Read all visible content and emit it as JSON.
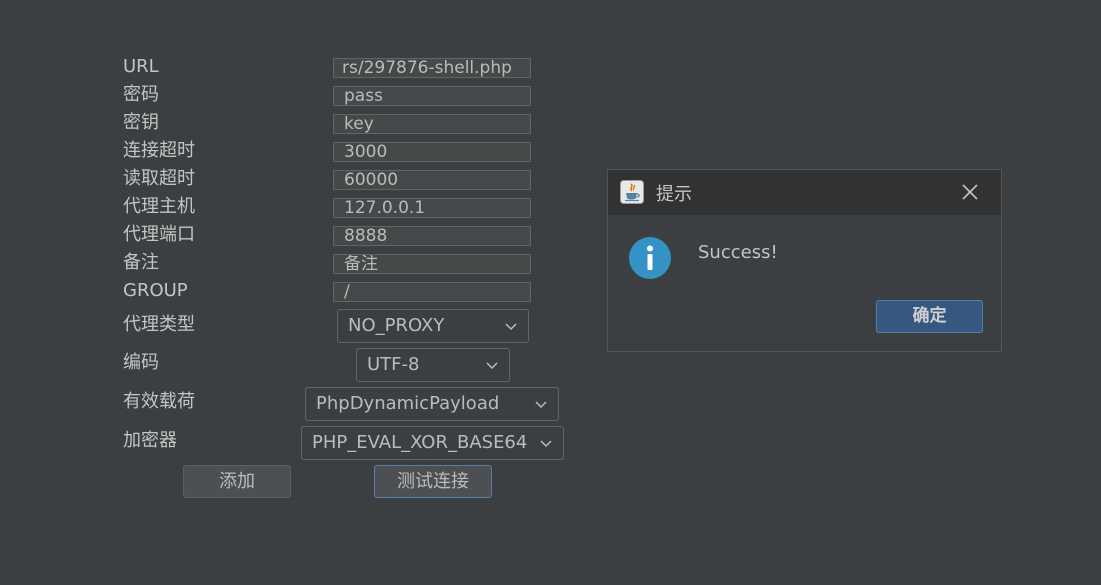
{
  "form": {
    "labels": {
      "url": "URL",
      "password": "密码",
      "key": "密钥",
      "connect_timeout": "连接超时",
      "read_timeout": "读取超时",
      "proxy_host": "代理主机",
      "proxy_port": "代理端口",
      "remark": "备注",
      "group": "GROUP",
      "proxy_type": "代理类型",
      "encoding": "编码",
      "payload": "有效载荷",
      "cryption": "加密器"
    },
    "values": {
      "url": "rs/297876-shell.php",
      "password": "pass",
      "key": "key",
      "connect_timeout": "3000",
      "read_timeout": "60000",
      "proxy_host": "127.0.0.1",
      "proxy_port": "8888",
      "remark": "备注",
      "group": "/"
    },
    "selects": {
      "proxy_type": "NO_PROXY",
      "encoding": "UTF-8",
      "payload": "PhpDynamicPayload",
      "cryption": "PHP_EVAL_XOR_BASE64"
    },
    "buttons": {
      "add": "添加",
      "test": "测试连接"
    }
  },
  "dialog": {
    "title": "提示",
    "message": "Success!",
    "ok_label": "确定",
    "icon": "info-icon"
  },
  "colors": {
    "background": "#3c3f41",
    "dialog_title_bg": "#323232",
    "info_blue": "#3592c4",
    "primary_button": "#365880"
  }
}
